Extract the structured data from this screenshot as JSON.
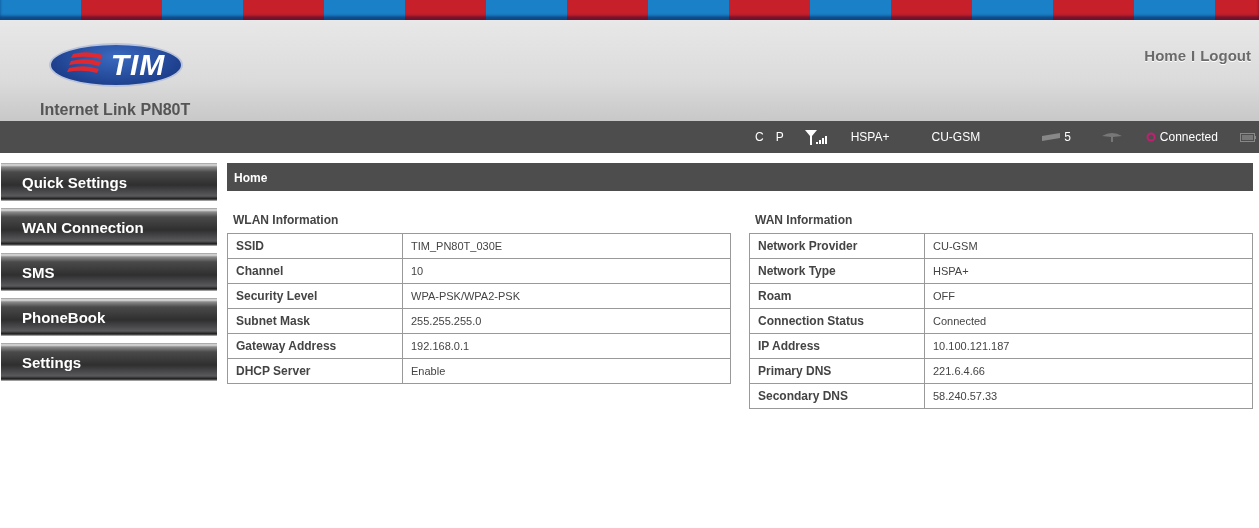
{
  "header": {
    "logo_text": "TIM",
    "product": "Internet Link PN80T",
    "links": [
      {
        "label": "Home"
      },
      {
        "label": "Logout"
      }
    ],
    "separator": "I"
  },
  "status_bar": {
    "items": [
      {
        "kind": "text",
        "text": "C"
      },
      {
        "kind": "text",
        "text": "P"
      },
      {
        "kind": "signal"
      },
      {
        "kind": "text",
        "text": "HSPA+"
      },
      {
        "kind": "text",
        "text": "CU-GSM"
      },
      {
        "kind": "sms",
        "text": "5"
      },
      {
        "kind": "roam"
      },
      {
        "kind": "connection",
        "text": "Connected"
      },
      {
        "kind": "battery"
      }
    ]
  },
  "sidebar": {
    "items": [
      {
        "label": "Quick Settings"
      },
      {
        "label": "WAN Connection"
      },
      {
        "label": "SMS"
      },
      {
        "label": "PhoneBook"
      },
      {
        "label": "Settings"
      }
    ]
  },
  "page_title": "Home",
  "panels": [
    {
      "title": "WLAN Information",
      "rows": [
        {
          "label": "SSID",
          "value": "TIM_PN80T_030E"
        },
        {
          "label": "Channel",
          "value": "10"
        },
        {
          "label": "Security Level",
          "value": "WPA-PSK/WPA2-PSK"
        },
        {
          "label": "Subnet Mask",
          "value": "255.255.255.0"
        },
        {
          "label": "Gateway Address",
          "value": "192.168.0.1"
        },
        {
          "label": "DHCP Server",
          "value": "Enable"
        }
      ]
    },
    {
      "title": "WAN Information",
      "rows": [
        {
          "label": "Network Provider",
          "value": "CU-GSM"
        },
        {
          "label": "Network Type",
          "value": "HSPA+"
        },
        {
          "label": "Roam",
          "value": "OFF"
        },
        {
          "label": "Connection Status",
          "value": "Connected"
        },
        {
          "label": "IP Address",
          "value": "10.100.121.187"
        },
        {
          "label": "Primary DNS",
          "value": "221.6.4.66"
        },
        {
          "label": "Secondary DNS",
          "value": "58.240.57.33"
        }
      ]
    }
  ]
}
